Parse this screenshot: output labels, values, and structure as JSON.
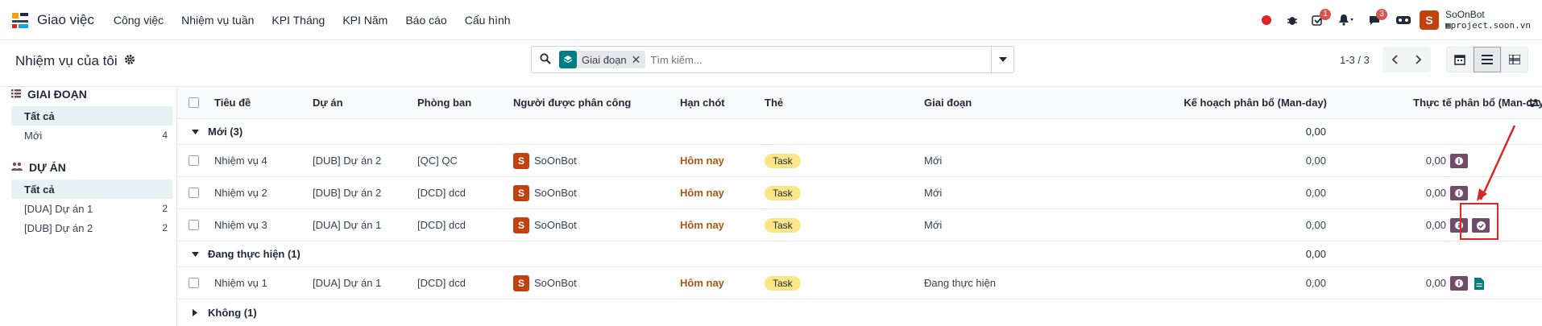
{
  "navbar": {
    "app_name": "Giao việc",
    "menu": [
      "Công việc",
      "Nhiệm vụ tuần",
      "KPI Tháng",
      "KPI Năm",
      "Báo cáo",
      "Cấu hình"
    ],
    "activity_badge": "1",
    "discuss_badge": "3",
    "avatar_letter": "S",
    "user_name": "SoOnBot",
    "user_db": "project.soon.vn"
  },
  "control": {
    "breadcrumb": "Nhiệm vụ của tôi",
    "facet_label": "Giai đoạn",
    "search_placeholder": "Tìm kiếm...",
    "pager": "1-3 / 3"
  },
  "sidebar": {
    "stage_title": "GIAI ĐOẠN",
    "stage_items": [
      {
        "label": "Tất cả",
        "count": ""
      },
      {
        "label": "Mới",
        "count": "4"
      }
    ],
    "project_title": "DỰ ÁN",
    "project_items": [
      {
        "label": "Tất cả",
        "count": ""
      },
      {
        "label": "[DUA] Dự án 1",
        "count": "2"
      },
      {
        "label": "[DUB] Dự án 2",
        "count": "2"
      }
    ]
  },
  "list": {
    "headers": {
      "title": "Tiêu đề",
      "project": "Dự án",
      "department": "Phòng ban",
      "assignee": "Người được phân công",
      "deadline": "Hạn chót",
      "tags": "Thẻ",
      "stage": "Giai đoạn",
      "planned": "Kế hoạch phân bổ (Man-day)",
      "actual": "Thực tế phân bổ (Man-day)"
    },
    "groups": [
      {
        "label": "Mới (3)",
        "planned": "0,00",
        "expanded": true
      },
      {
        "label": "Đang thực hiện (1)",
        "planned": "0,00",
        "expanded": true
      },
      {
        "label": "Không (1)",
        "planned": "",
        "expanded": false
      }
    ],
    "rows": [
      {
        "title": "Nhiệm vụ 4",
        "project": "[DUB] Dự án 2",
        "department": "[QC] QC",
        "assignee": "SoOnBot",
        "avatar": "S",
        "deadline": "Hôm nay",
        "tag": "Task",
        "stage": "Mới",
        "planned": "0,00",
        "actual": "0,00"
      },
      {
        "title": "Nhiệm vụ 2",
        "project": "[DUB] Dự án 2",
        "department": "[DCD] dcd",
        "assignee": "SoOnBot",
        "avatar": "S",
        "deadline": "Hôm nay",
        "tag": "Task",
        "stage": "Mới",
        "planned": "0,00",
        "actual": "0,00"
      },
      {
        "title": "Nhiệm vụ 3",
        "project": "[DUA] Dự án 1",
        "department": "[DCD] dcd",
        "assignee": "SoOnBot",
        "avatar": "S",
        "deadline": "Hôm nay",
        "tag": "Task",
        "stage": "Mới",
        "planned": "0,00",
        "actual": "0,00"
      },
      {
        "title": "Nhiệm vụ 1",
        "project": "[DUA] Dự án 1",
        "department": "[DCD] dcd",
        "assignee": "SoOnBot",
        "avatar": "S",
        "deadline": "Hôm nay",
        "tag": "Task",
        "stage": "Đang thực hiện",
        "planned": "0,00",
        "actual": "0,00"
      }
    ]
  },
  "colors": {
    "accent": "#017e84",
    "brand": "#714b67",
    "deadline": "#b45309",
    "tag": "#fde68a",
    "annotation": "#dc2626"
  }
}
